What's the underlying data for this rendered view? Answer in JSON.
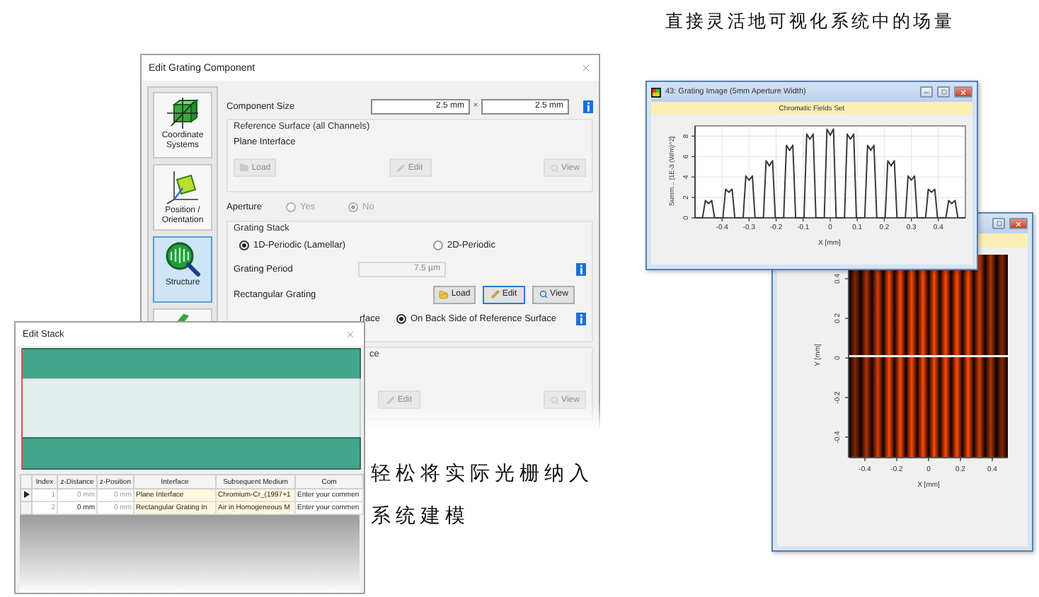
{
  "caption_top": "直接灵活地可视化系统中的场量",
  "caption_left": [
    "轻松将实际光栅纳入",
    "系统建模"
  ],
  "grating_dialog": {
    "title": "Edit Grating Component",
    "sidebar": [
      {
        "kind": "axes",
        "label": "Coordinate Systems",
        "selected": false
      },
      {
        "kind": "tilt",
        "label": "Position / Orientation",
        "selected": false
      },
      {
        "kind": "magnifier",
        "label": "Structure",
        "selected": true
      },
      {
        "kind": "partial",
        "selected": false
      }
    ],
    "component_size": {
      "label": "Component Size",
      "width": "2.5 mm",
      "separator": "×",
      "height": "2.5 mm"
    },
    "reference_surface": {
      "title": "Reference Surface (all Channels)",
      "interface": "Plane Interface",
      "buttons": [
        {
          "kind": "load",
          "label": "Load",
          "disabled": true
        },
        {
          "kind": "edit",
          "label": "Edit",
          "disabled": true
        },
        {
          "kind": "view",
          "label": "View",
          "disabled": true
        }
      ]
    },
    "aperture": {
      "label": "Aperture",
      "options": [
        {
          "label": "Yes",
          "selected": false,
          "disabled": true
        },
        {
          "label": "No",
          "selected": true,
          "disabled": true
        }
      ]
    },
    "grating_stack": {
      "title": "Grating Stack",
      "types": [
        {
          "label": "1D-Periodic (Lamellar)",
          "selected": true
        },
        {
          "label": "2D-Periodic",
          "selected": false
        }
      ],
      "period": {
        "label": "Grating Period",
        "value": "7.5 µm",
        "disabled": true
      },
      "structure": {
        "label": "Rectangular Grating",
        "buttons": [
          {
            "kind": "load",
            "label": "Load",
            "disabled": false,
            "focused": false
          },
          {
            "kind": "edit",
            "label": "Edit",
            "disabled": false,
            "focused": true
          },
          {
            "kind": "view",
            "label": "View",
            "disabled": false,
            "focused": false
          }
        ]
      },
      "side": {
        "cut_label": "rface",
        "options": [
          {
            "label": "On Back Side of Reference Surface",
            "selected": true
          }
        ]
      }
    },
    "lower_group": {
      "title": "ce",
      "buttons": [
        {
          "kind": "edit",
          "label": "Edit",
          "disabled": true
        },
        {
          "kind": "view",
          "label": "View",
          "disabled": true
        }
      ]
    }
  },
  "edit_stack": {
    "title": "Edit Stack",
    "columns": [
      "Index",
      "z-Distance",
      "z-Position",
      "Interface",
      "Subsequent Medium",
      "Com"
    ],
    "rows": [
      {
        "selected": true,
        "cells": [
          "1",
          "0 mm",
          "0 mm",
          "Plane Interface",
          "Chromium-Cr_(1997+1",
          "Enter your commen"
        ]
      },
      {
        "selected": false,
        "cells": [
          "2",
          "0 mm",
          "0 mm",
          "Rectangular Grating In",
          "Air in Homogeneous M",
          "Enter your commen"
        ]
      }
    ]
  },
  "plot_window": {
    "title": "43: Grating Image (5mm Aperture Width)",
    "banner": "Chromatic Fields Set",
    "chart_data": {
      "type": "line",
      "xlabel": "X [mm]",
      "ylabel": "Summ... [1E-3 (W/m)^2]",
      "grid": true,
      "xlim": [
        -0.5,
        0.5
      ],
      "ylim": [
        0,
        9
      ],
      "xticks": [
        -0.4,
        -0.3,
        -0.2,
        -0.1,
        0,
        0.1,
        0.2,
        0.3,
        0.4
      ],
      "yticks": [
        0,
        2,
        4,
        6,
        8
      ],
      "x": [
        -0.5,
        -0.472,
        -0.462,
        -0.45,
        -0.438,
        -0.428,
        -0.397,
        -0.387,
        -0.375,
        -0.363,
        -0.353,
        -0.322,
        -0.312,
        -0.3,
        -0.288,
        -0.278,
        -0.247,
        -0.237,
        -0.225,
        -0.213,
        -0.203,
        -0.172,
        -0.162,
        -0.15,
        -0.138,
        -0.128,
        -0.097,
        -0.087,
        -0.075,
        -0.063,
        -0.053,
        -0.022,
        -0.012,
        0,
        0.012,
        0.022,
        0.053,
        0.063,
        0.075,
        0.087,
        0.097,
        0.128,
        0.138,
        0.15,
        0.162,
        0.172,
        0.203,
        0.213,
        0.225,
        0.237,
        0.247,
        0.278,
        0.288,
        0.3,
        0.312,
        0.322,
        0.353,
        0.363,
        0.375,
        0.387,
        0.397,
        0.428,
        0.438,
        0.45,
        0.462,
        0.472,
        0.5
      ],
      "values": [
        0,
        0,
        1.7,
        1.4,
        1.7,
        0,
        0,
        2.8,
        2.5,
        2.8,
        0,
        0,
        4.1,
        3.7,
        4.1,
        0,
        0,
        5.6,
        5.1,
        5.6,
        0,
        0,
        7.1,
        6.6,
        7.1,
        0,
        0,
        8.2,
        7.7,
        8.2,
        0,
        0,
        8.7,
        8.1,
        8.7,
        0,
        0,
        8.2,
        7.7,
        8.2,
        0,
        0,
        7.1,
        6.6,
        7.1,
        0,
        0,
        5.6,
        5.1,
        5.6,
        0,
        0,
        4.1,
        3.7,
        4.1,
        0,
        0,
        2.8,
        2.5,
        2.8,
        0,
        0,
        1.7,
        1.4,
        1.7,
        0,
        0
      ]
    }
  },
  "field_window": {
    "xlabel": "X [mm]",
    "ylabel": "Y [mm]",
    "x_tick_labels": [
      "-0.4",
      "-0.2",
      "0",
      "0.2",
      "0.4"
    ],
    "y_tick_labels": [
      "0.4",
      "0.2",
      "0",
      "-0.2",
      "-0.4"
    ]
  }
}
